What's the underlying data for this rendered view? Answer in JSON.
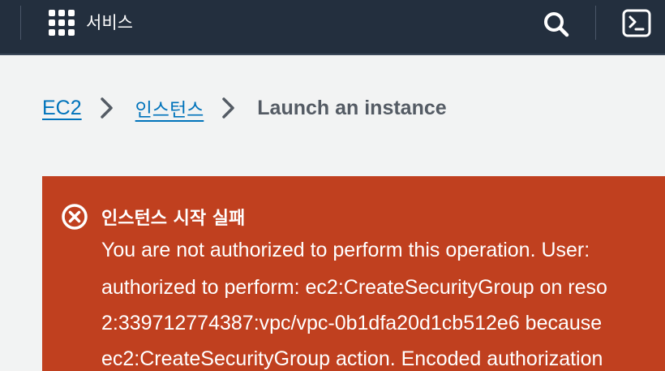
{
  "header": {
    "services_label": "서비스"
  },
  "breadcrumb": {
    "items": [
      "EC2",
      "인스턴스"
    ],
    "current": "Launch an instance"
  },
  "alert": {
    "title": "인스턴스 시작 실패",
    "lines": [
      "You are not authorized to perform this operation. User:",
      "authorized to perform: ec2:CreateSecurityGroup on reso",
      "2:339712774387:vpc/vpc-0b1dfa20d1cb512e6 because",
      "ec2:CreateSecurityGroup action. Encoded authorization"
    ]
  },
  "colors": {
    "topbar": "#232f3e",
    "link": "#0073bb",
    "alert_background": "#c0401f",
    "page_background": "#f2f3f3"
  }
}
